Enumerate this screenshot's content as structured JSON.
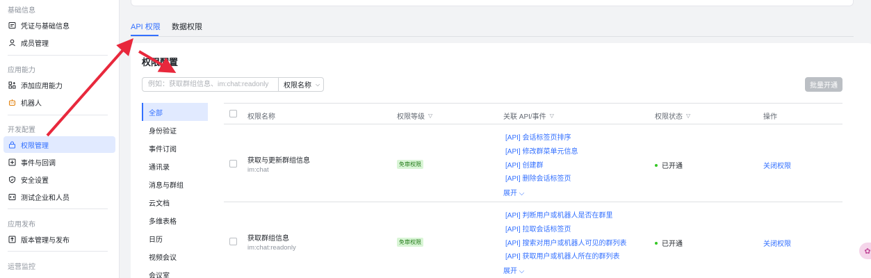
{
  "sidebar": {
    "groups": [
      {
        "title": "基础信息",
        "items": [
          {
            "label": "凭证与基础信息",
            "icon": "id-card-icon"
          },
          {
            "label": "成员管理",
            "icon": "user-icon"
          }
        ]
      },
      {
        "title": "应用能力",
        "items": [
          {
            "label": "添加应用能力",
            "icon": "apps-add-icon"
          },
          {
            "label": "机器人",
            "icon": "robot-icon"
          }
        ]
      },
      {
        "title": "开发配置",
        "items": [
          {
            "label": "权限管理",
            "icon": "lock-icon",
            "active": true
          },
          {
            "label": "事件与回调",
            "icon": "plus-square-icon"
          },
          {
            "label": "安全设置",
            "icon": "shield-icon"
          },
          {
            "label": "测试企业和人员",
            "icon": "code-icon"
          }
        ]
      },
      {
        "title": "应用发布",
        "items": [
          {
            "label": "版本管理与发布",
            "icon": "upload-icon"
          }
        ]
      },
      {
        "title": "运营监控",
        "items": []
      }
    ]
  },
  "tabs": [
    {
      "label": "API 权限",
      "active": true
    },
    {
      "label": "数据权限",
      "active": false
    }
  ],
  "main": {
    "title": "权限配置",
    "search_placeholder": "例如：获取群组信息、im:chat:readonly",
    "select_label": "权限名称",
    "batch_button": "批量开通"
  },
  "categories": [
    "全部",
    "身份验证",
    "事件订阅",
    "通讯录",
    "消息与群组",
    "云文档",
    "多维表格",
    "日历",
    "视频会议",
    "会议室"
  ],
  "table": {
    "headers": {
      "name": "权限名称",
      "level": "权限等级",
      "api": "关联 API/事件",
      "status": "权限状态",
      "action": "操作"
    },
    "rows": [
      {
        "name": "获取与更新群组信息",
        "code": "im:chat",
        "badge": "免审权限",
        "apis": [
          "[API] 会话标签页排序",
          "[API] 修改群菜单元信息",
          "[API] 创建群",
          "[API] 删除会话标签页"
        ],
        "expand": "展开",
        "status": "已开通",
        "action": "关闭权限"
      },
      {
        "name": "获取群组信息",
        "code": "im:chat:readonly",
        "badge": "免审权限",
        "apis": [
          "[API] 判断用户或机器人是否在群里",
          "[API] 拉取会话标签页",
          "[API] 搜索对用户或机器人可见的群列表",
          "[API] 获取用户或机器人所在的群列表"
        ],
        "expand": "展开",
        "status": "已开通",
        "action": "关闭权限"
      }
    ]
  },
  "colors": {
    "accent": "#3370ff",
    "annotation_arrow": "#e8283c",
    "status_green": "#34c724"
  }
}
